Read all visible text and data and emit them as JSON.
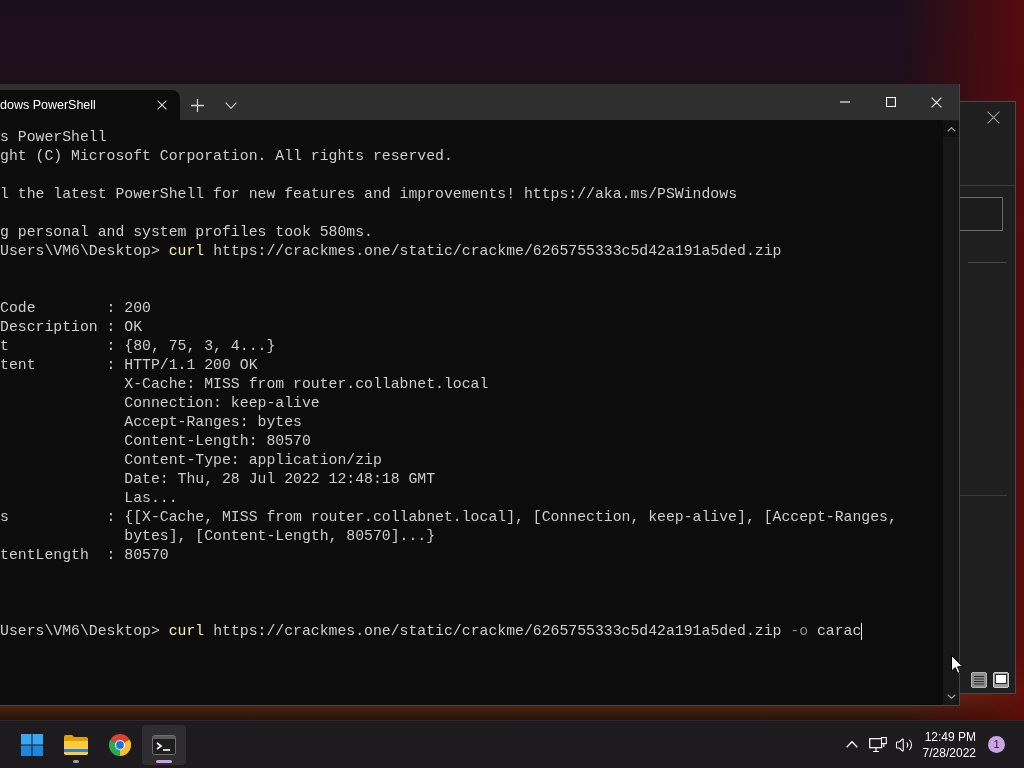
{
  "terminal": {
    "tabs": [
      {
        "title": "dows PowerShell",
        "selected": true
      }
    ],
    "lines": [
      {
        "kind": "text",
        "text": "s PowerShell"
      },
      {
        "kind": "text",
        "text": "ght (C) Microsoft Corporation. All rights reserved."
      },
      {
        "kind": "blank"
      },
      {
        "kind": "text",
        "text": "l the latest PowerShell for new features and improvements! https://aka.ms/PSWindows"
      },
      {
        "kind": "blank"
      },
      {
        "kind": "text",
        "text": "g personal and system profiles took 580ms."
      },
      {
        "kind": "prompt",
        "prompt": "Users\\VM6\\Desktop>",
        "tokens": [
          {
            "kind": "command",
            "text": "curl"
          },
          {
            "kind": "argument",
            "text": "https://crackmes.one/static/crackme/6265755333c5d42a191a5ded.zip"
          }
        ],
        "cursor": false
      },
      {
        "kind": "blank"
      },
      {
        "kind": "blank"
      },
      {
        "kind": "property",
        "name": "Code",
        "separator": ":",
        "value": "200"
      },
      {
        "kind": "property",
        "name": "Description",
        "separator": ":",
        "value": "OK"
      },
      {
        "kind": "property",
        "name": "t",
        "separator": ":",
        "value": "{80, 75, 3, 4...}"
      },
      {
        "kind": "property",
        "name": "tent",
        "separator": ":",
        "value": "HTTP/1.1 200 OK"
      },
      {
        "kind": "continuation",
        "value": "X-Cache: MISS from router.collabnet.local"
      },
      {
        "kind": "continuation",
        "value": "Connection: keep-alive"
      },
      {
        "kind": "continuation",
        "value": "Accept-Ranges: bytes"
      },
      {
        "kind": "continuation",
        "value": "Content-Length: 80570"
      },
      {
        "kind": "continuation",
        "value": "Content-Type: application/zip"
      },
      {
        "kind": "continuation",
        "value": "Date: Thu, 28 Jul 2022 12:48:18 GMT"
      },
      {
        "kind": "continuation",
        "value": "Las..."
      },
      {
        "kind": "property",
        "name": "s",
        "separator": ":",
        "value": "{[X-Cache, MISS from router.collabnet.local], [Connection, keep-alive], [Accept-Ranges,"
      },
      {
        "kind": "continuation",
        "value": "bytes], [Content-Length, 80570]...}"
      },
      {
        "kind": "property",
        "name": "tentLength",
        "separator": ":",
        "value": "80570"
      },
      {
        "kind": "blank"
      },
      {
        "kind": "blank"
      },
      {
        "kind": "blank"
      },
      {
        "kind": "prompt",
        "prompt": "Users\\VM6\\Desktop>",
        "tokens": [
          {
            "kind": "command",
            "text": "curl"
          },
          {
            "kind": "argument",
            "text": "https://crackmes.one/static/crackme/6265755333c5d42a191a5ded.zip"
          },
          {
            "kind": "parameter",
            "text": "-o"
          },
          {
            "kind": "argument",
            "text": "carac"
          }
        ],
        "cursor": true
      }
    ]
  },
  "taskbar": {
    "apps": [
      {
        "kind": "start",
        "running": false,
        "selected": false
      },
      {
        "kind": "folder",
        "running": true,
        "selected": false
      },
      {
        "kind": "browser",
        "running": false,
        "selected": false
      },
      {
        "kind": "terminal",
        "running": true,
        "selected": true
      }
    ],
    "clock": {
      "time": "12:49 PM",
      "date": "7/28/2022"
    },
    "notifications": "1"
  }
}
